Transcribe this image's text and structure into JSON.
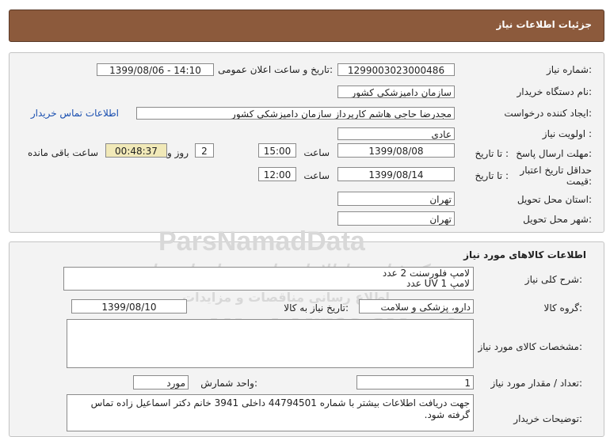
{
  "header": {
    "title": "جزئیات اطلاعات نیاز"
  },
  "details": {
    "need_number_label": "شماره نیاز:",
    "need_number": "1299003023000486",
    "announce_label": "تاریخ و ساعت اعلان عمومی:",
    "announce_value": "1399/08/06 - 14:10",
    "buyer_org_label": "نام دستگاه خریدار:",
    "buyer_org": "سازمان دامپزشکی کشور",
    "creator_label": "ایجاد کننده درخواست:",
    "creator": "مجدرضا حاجی هاشم کارپرداز سازمان دامپزشکی کشور",
    "contact_link": "اطلاعات تماس خریدار",
    "priority_label": "اولویت نیاز :",
    "priority": "عادی",
    "deadline_label": "مهلت ارسال پاسخ:",
    "until_date_label": "تا تاریخ :",
    "deadline_date": "1399/08/08",
    "time_label": "ساعت",
    "deadline_time": "15:00",
    "days_value": "2",
    "days_label": "روز و",
    "remaining_time": "00:48:37",
    "remaining_label": "ساعت باقی مانده",
    "validity_label": "حداقل تاریخ اعتبار قیمت:",
    "validity_date": "1399/08/14",
    "validity_time": "12:00",
    "province_label": "استان محل تحویل:",
    "province": "تهران",
    "city_label": "شهر محل تحویل:",
    "city": "تهران"
  },
  "goods": {
    "section_title": "اطلاعات کالاهای مورد نیاز",
    "desc_label": "شرح کلی نیاز:",
    "desc_line1": "لامپ فلورسنت 2 عدد",
    "desc_line2": "لامپ UV 1 عدد",
    "group_label": "گروه کالا:",
    "group": "دارو، پزشکی و سلامت",
    "need_date_label": "تاریخ نیاز به کالا:",
    "need_date": "1399/08/10",
    "specs_label": "مشخصات کالای مورد نیاز:",
    "count_label": "تعداد / مقدار مورد نیاز:",
    "count": "1",
    "unit_label": "واحد شمارش:",
    "unit": "مورد",
    "buyer_notes_label": "توضیحات خریدار:",
    "buyer_notes": "جهت دریافت اطلاعات بیشتر با شماره 44794501 داخلی 3941 خانم دکتر اسماعیل زاده تماس گرفته شود."
  },
  "watermark": {
    "brand": "ParsNamadData",
    "slogan": "مرکز فناوری اطلاعات پارس نماد داده ها",
    "slogan2": "اطلاع رسانی مناقصات و مزایدات",
    "phone": "۰۲۱-۸۸۳۴۹۶۷۰-۵"
  },
  "colors": {
    "header_bg": "#8c5a3c",
    "panel_bg": "#f3f3f3",
    "timer_bg": "#f1e9b8",
    "link": "#1a4fb0"
  }
}
